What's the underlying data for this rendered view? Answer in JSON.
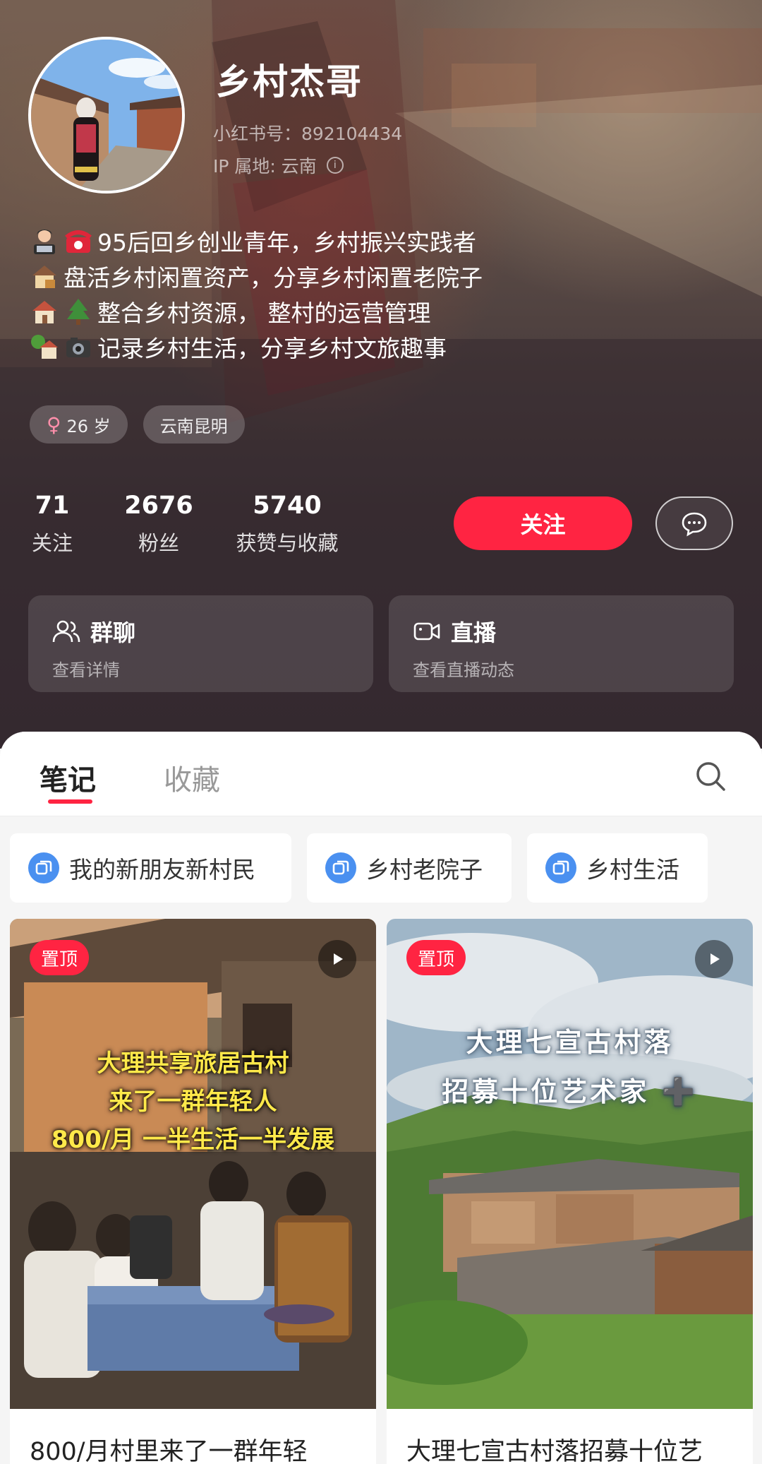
{
  "profile": {
    "nickname": "乡村杰哥",
    "red_id": "小红书号：892104434",
    "ip_location": "IP 属地: 云南",
    "bio": [
      {
        "icons": [
          "technologist-emoji",
          "telephone-emoji"
        ],
        "text": "95后回乡创业青年，乡村振兴实践者"
      },
      {
        "icons": [
          "house-with-box-emoji"
        ],
        "text": "盘活乡村闲置资产，分享乡村闲置老院子"
      },
      {
        "icons": [
          "house-emoji",
          "evergreen-tree-emoji"
        ],
        "text": " 整合乡村资源， 整村的运营管理"
      },
      {
        "icons": [
          "house-with-garden-emoji",
          "camera-emoji"
        ],
        "text": "记录乡村生活，分享乡村文旅趣事"
      }
    ],
    "tags": {
      "age": "26 岁",
      "location": "云南昆明"
    },
    "stats": [
      {
        "value": "71",
        "label": "关注"
      },
      {
        "value": "2676",
        "label": "粉丝"
      },
      {
        "value": "5740",
        "label": "获赞与收藏"
      }
    ],
    "follow_label": "关注"
  },
  "cards": [
    {
      "icon": "group-chat-icon",
      "title": "群聊",
      "subtitle": "查看详情"
    },
    {
      "icon": "live-camera-icon",
      "title": "直播",
      "subtitle": "查看直播动态"
    }
  ],
  "tabs": [
    {
      "label": "笔记",
      "active": true
    },
    {
      "label": "收藏",
      "active": false
    }
  ],
  "collections": [
    "我的新朋友新村民",
    "乡村老院子",
    "乡村生活"
  ],
  "notes": [
    {
      "badge": "置顶",
      "overlay": [
        "大理共享旅居古村",
        "来了一群年轻人",
        "800/月 一半生活一半发展"
      ],
      "title": "800/月村里来了一群年轻"
    },
    {
      "badge": "置顶",
      "overlay": [
        "大理七宣古村落",
        "招募十位艺术家 ➕"
      ],
      "title": "大理七宣古村落招募十位艺"
    }
  ],
  "colors": {
    "accent": "#ff2442",
    "collection_icon": "#4a90f0",
    "header_bg": "#3f3437"
  }
}
